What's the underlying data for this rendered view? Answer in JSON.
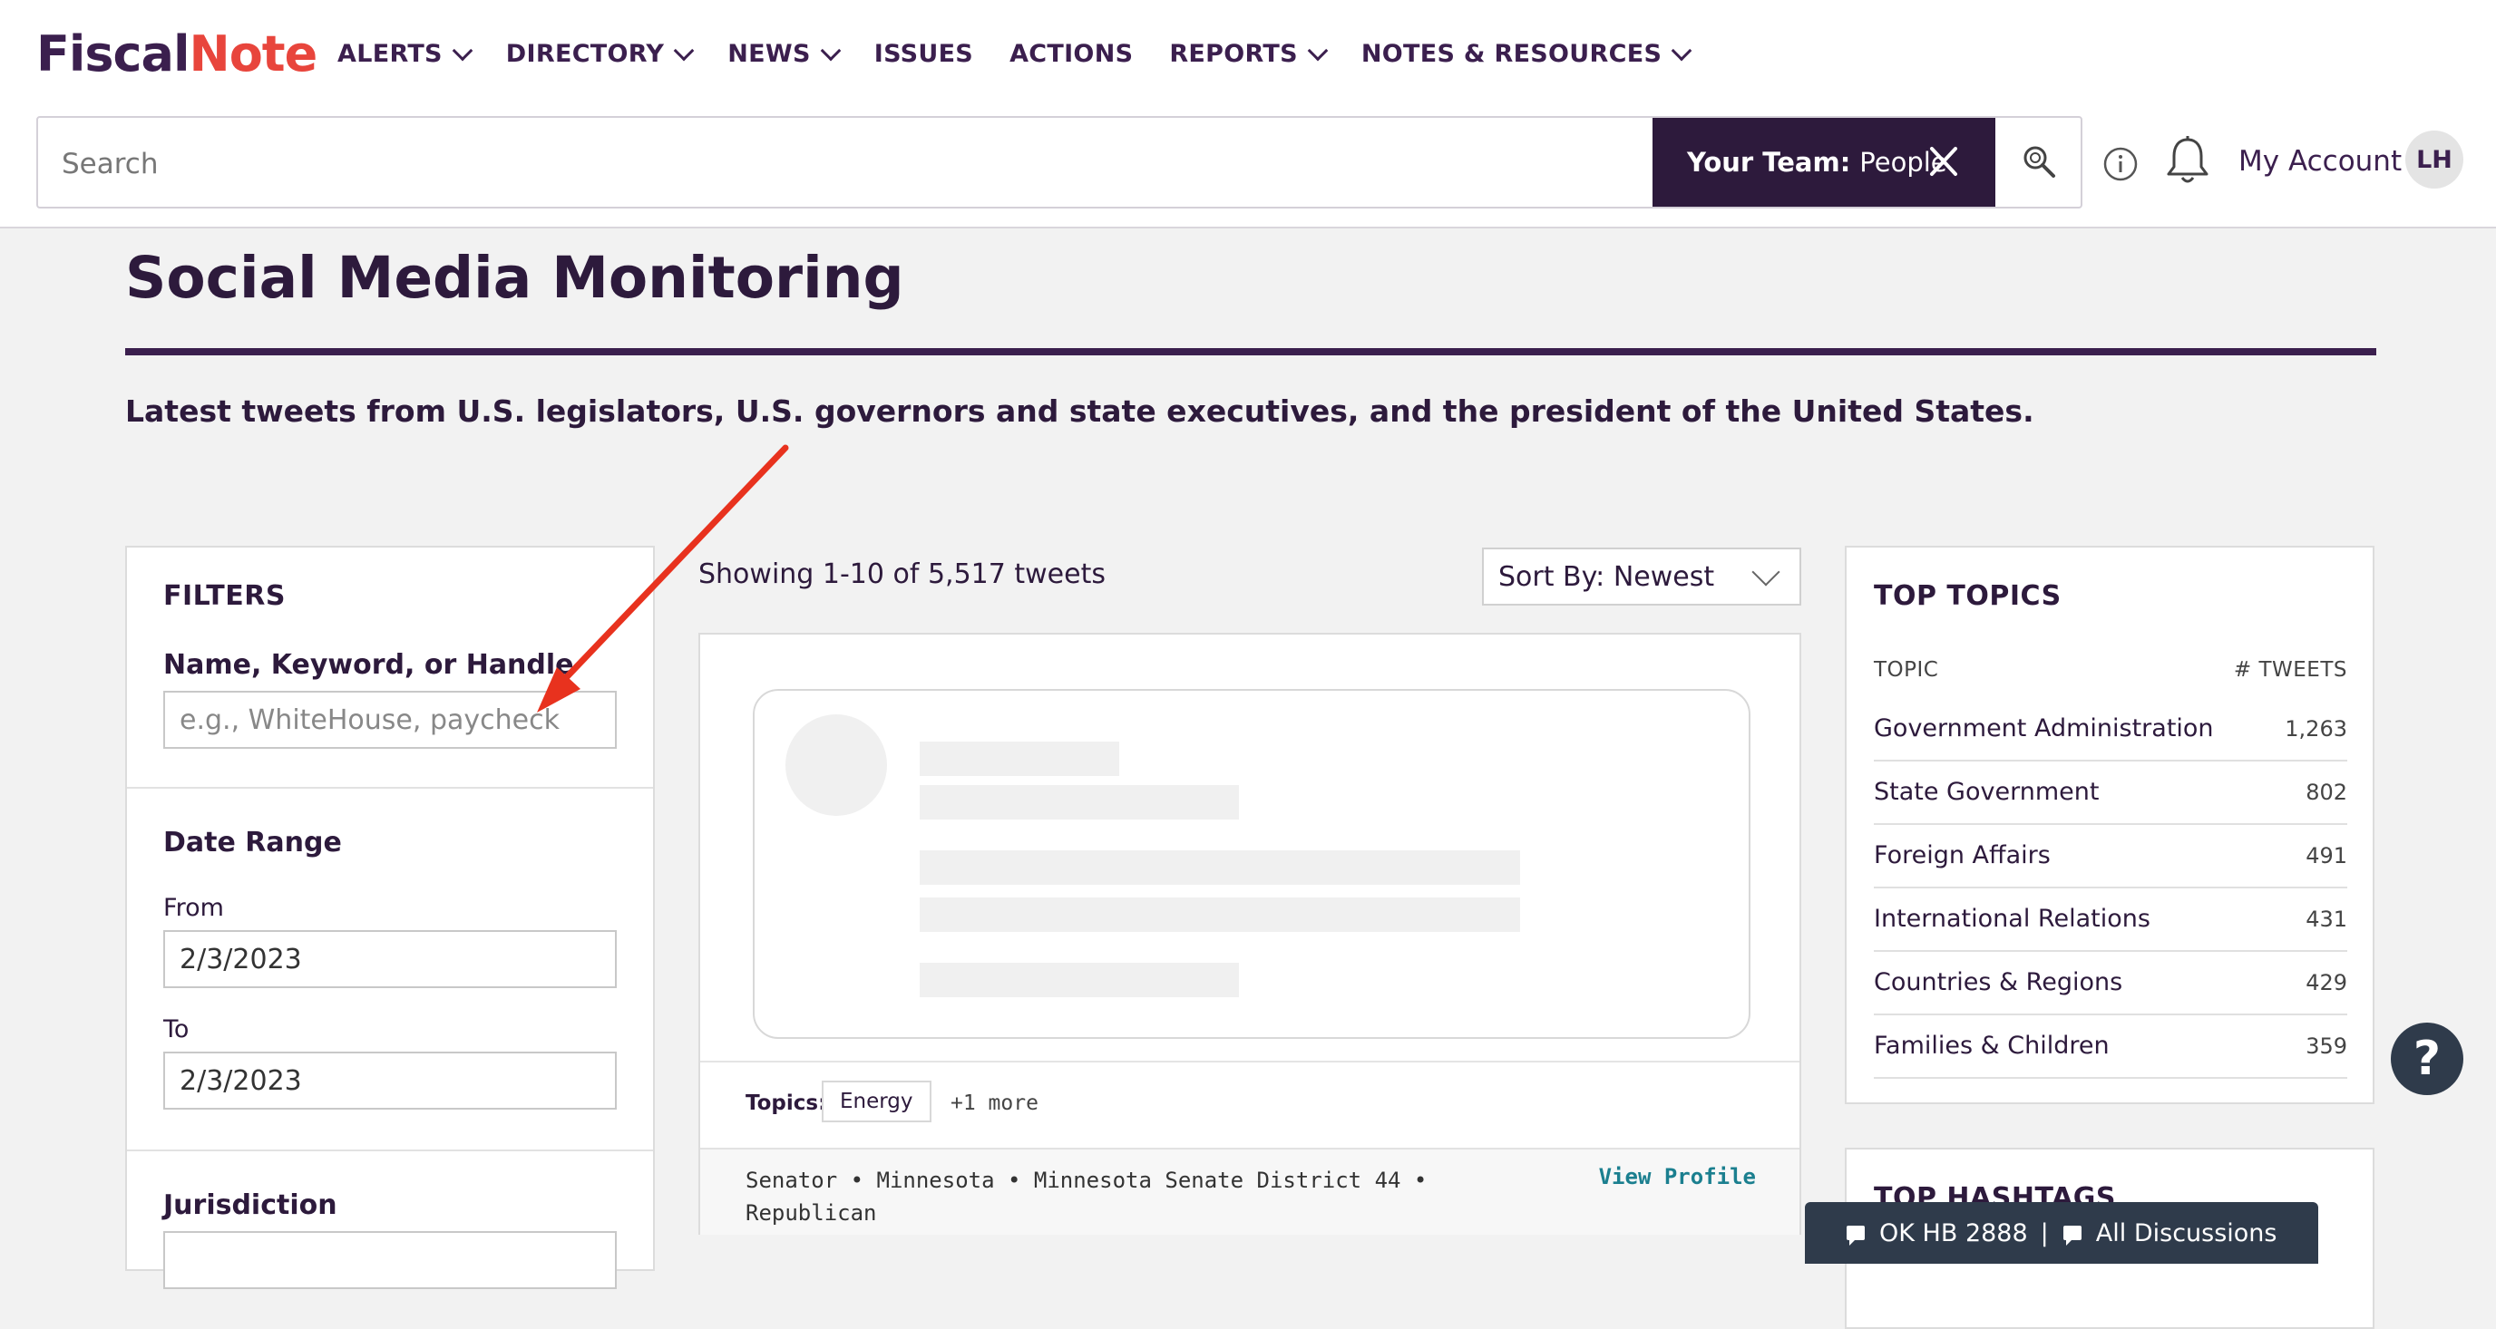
{
  "brand": {
    "part1": "Fiscal",
    "part2": "Note"
  },
  "nav": [
    {
      "label": "ALERTS",
      "dropdown": true
    },
    {
      "label": "DIRECTORY",
      "dropdown": true
    },
    {
      "label": "NEWS",
      "dropdown": true
    },
    {
      "label": "ISSUES",
      "dropdown": false
    },
    {
      "label": "ACTIONS",
      "dropdown": false
    },
    {
      "label": "REPORTS",
      "dropdown": true
    },
    {
      "label": "NOTES & RESOURCES",
      "dropdown": true
    }
  ],
  "search": {
    "placeholder": "Search",
    "team_label": "Your Team:",
    "team_value": "People"
  },
  "account": {
    "label": "My Account",
    "initials": "LH"
  },
  "page": {
    "title": "Social Media Monitoring",
    "subtitle": "Latest tweets from U.S. legislators, U.S. governors and state executives, and the president of the United States."
  },
  "filters": {
    "title": "FILTERS",
    "keyword_label": "Name, Keyword, or Handle",
    "keyword_placeholder": "e.g., WhiteHouse, paycheck",
    "date_range_label": "Date Range",
    "from_label": "From",
    "from_value": "2/3/2023",
    "to_label": "To",
    "to_value": "2/3/2023",
    "jurisdiction_label": "Jurisdiction"
  },
  "results": {
    "showing": "Showing 1-10 of 5,517 tweets",
    "sort": "Sort By: Newest"
  },
  "tweet": {
    "topics_label": "Topics:",
    "topic_chip": "Energy",
    "more": "+1 more",
    "meta": "Senator • Minnesota • Minnesota Senate District 44 • Republican",
    "view_profile": "View Profile"
  },
  "top_topics": {
    "title": "TOP TOPICS",
    "col_topic": "TOPIC",
    "col_tweets": "# TWEETS",
    "rows": [
      {
        "name": "Government Administration",
        "count": "1,263"
      },
      {
        "name": "State Government",
        "count": "802"
      },
      {
        "name": "Foreign Affairs",
        "count": "491"
      },
      {
        "name": "International Relations",
        "count": "431"
      },
      {
        "name": "Countries & Regions",
        "count": "429"
      },
      {
        "name": "Families & Children",
        "count": "359"
      }
    ]
  },
  "top_hashtags": {
    "title": "TOP HASHTAGS"
  },
  "discussions": {
    "item1": "OK HB 2888",
    "divider": "|",
    "item2": "All Discussions"
  },
  "help": {
    "label": "?"
  },
  "annotation": {
    "arrow_color": "#e8321e"
  },
  "colors": {
    "brand_purple": "#3b1f4e",
    "brand_red": "#e8453c",
    "link_teal": "#1b7f8f",
    "dark_slate": "#2f3b4b"
  }
}
